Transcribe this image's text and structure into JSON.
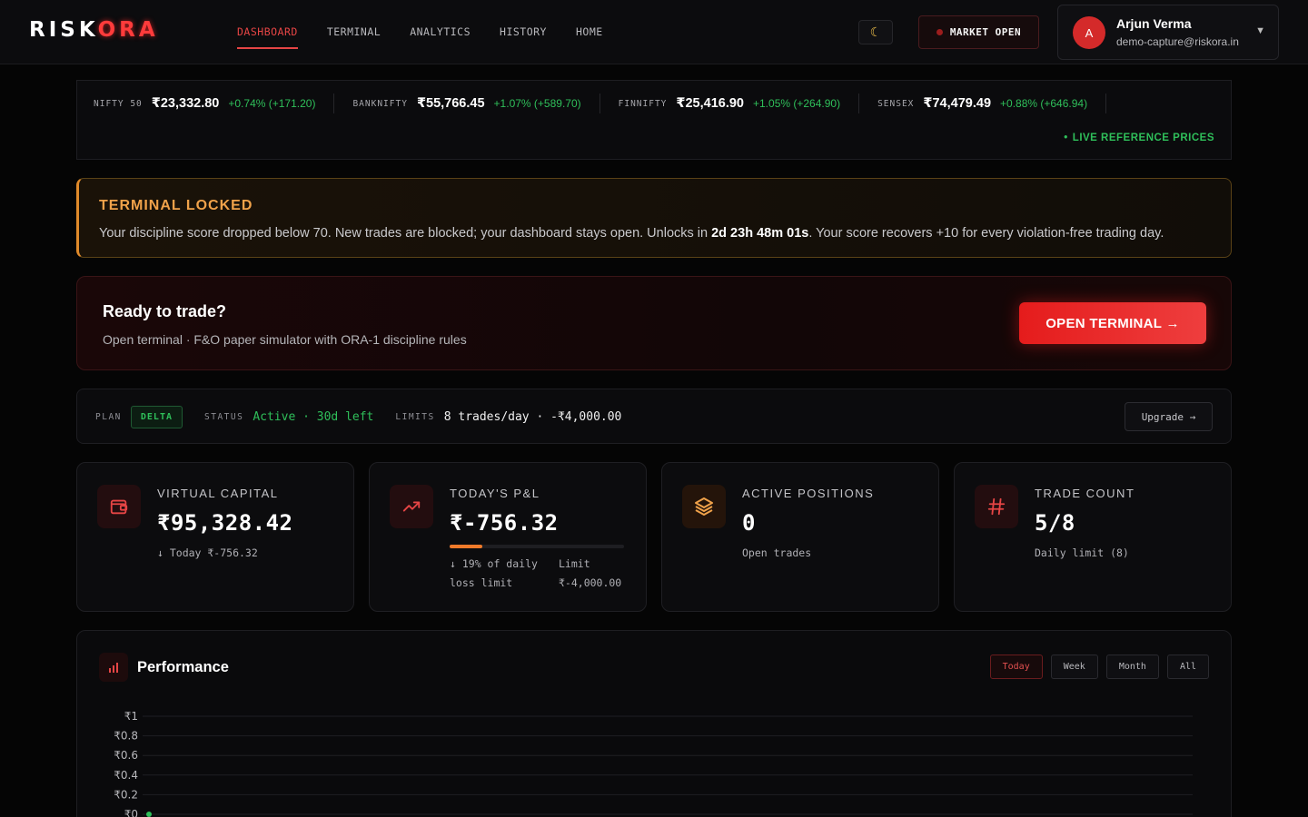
{
  "brand": {
    "logo_pre": "RISK",
    "logo_accent": "ORA"
  },
  "nav": {
    "items": [
      {
        "label": "DASHBOARD",
        "active": true
      },
      {
        "label": "TERMINAL",
        "active": false
      },
      {
        "label": "ANALYTICS",
        "active": false
      },
      {
        "label": "HISTORY",
        "active": false
      },
      {
        "label": "HOME",
        "active": false
      }
    ],
    "theme_icon": "moon-icon",
    "market_status": "MARKET OPEN"
  },
  "user": {
    "initial": "A",
    "name": "Arjun Verma",
    "email": "demo-capture@riskora.in"
  },
  "ticker": {
    "items": [
      {
        "name": "NIFTY 50",
        "price": "₹23,332.80",
        "change": "+0.74% (+171.20)"
      },
      {
        "name": "BANKNIFTY",
        "price": "₹55,766.45",
        "change": "+1.07% (+589.70)"
      },
      {
        "name": "FINNIFTY",
        "price": "₹25,416.90",
        "change": "+1.05% (+264.90)"
      },
      {
        "name": "SENSEX",
        "price": "₹74,479.49",
        "change": "+0.88% (+646.94)"
      }
    ],
    "live_label": "LIVE REFERENCE PRICES"
  },
  "locked": {
    "title": "TERMINAL LOCKED",
    "text_before": "Your discipline score dropped below 70. New trades are blocked; your dashboard stays open. Unlocks in ",
    "countdown": "2d 23h 48m 01s",
    "text_after": ". Your score recovers +10 for every violation-free trading day."
  },
  "ready": {
    "title": "Ready to trade?",
    "subtitle": "Open terminal · F&O paper simulator with ORA-1 discipline rules",
    "button": "OPEN TERMINAL →"
  },
  "plan": {
    "plan_label": "PLAN",
    "plan_value": "DELTA",
    "status_label": "STATUS",
    "status_value": "Active · 30d left",
    "limits_label": "LIMITS",
    "limits_value": "8 trades/day · -₹4,000.00",
    "upgrade": "Upgrade →"
  },
  "cards": {
    "capital": {
      "label": "VIRTUAL CAPITAL",
      "value": "₹95,328.42",
      "sub": "↓ Today ₹-756.32",
      "icon": "wallet-icon"
    },
    "pnl": {
      "label": "TODAY'S P&L",
      "value": "₹-756.32",
      "progress": 0.19,
      "sub_left": "↓ 19% of daily loss limit",
      "sub_right_label": "Limit",
      "sub_right_value": "₹-4,000.00",
      "icon": "trend-icon"
    },
    "positions": {
      "label": "ACTIVE POSITIONS",
      "value": "0",
      "sub": "Open trades",
      "icon": "layers-icon"
    },
    "trades": {
      "label": "TRADE COUNT",
      "value": "5/8",
      "sub": "Daily limit (8)",
      "icon": "hash-icon"
    }
  },
  "performance": {
    "title": "Performance",
    "icon": "bar-chart-icon",
    "ranges": [
      {
        "label": "Today",
        "active": true
      },
      {
        "label": "Week",
        "active": false
      },
      {
        "label": "Month",
        "active": false
      },
      {
        "label": "All",
        "active": false
      }
    ]
  },
  "chart_data": {
    "type": "line",
    "title": "",
    "xlabel": "",
    "ylabel": "",
    "ylim": [
      0,
      1
    ],
    "y_ticks": [
      "₹1",
      "₹0.8",
      "₹0.6",
      "₹0.4",
      "₹0.2",
      "₹0"
    ],
    "y_tick_values": [
      1,
      0.8,
      0.6,
      0.4,
      0.2,
      0
    ],
    "series": [
      {
        "values": [
          0
        ]
      }
    ],
    "grid": true,
    "colors": {
      "point": "#2fbf5a",
      "grid": "#1f1f23"
    }
  },
  "colors": {
    "accent": "#e64545",
    "positive": "#2fbf5a",
    "warning": "#f0a24a"
  }
}
